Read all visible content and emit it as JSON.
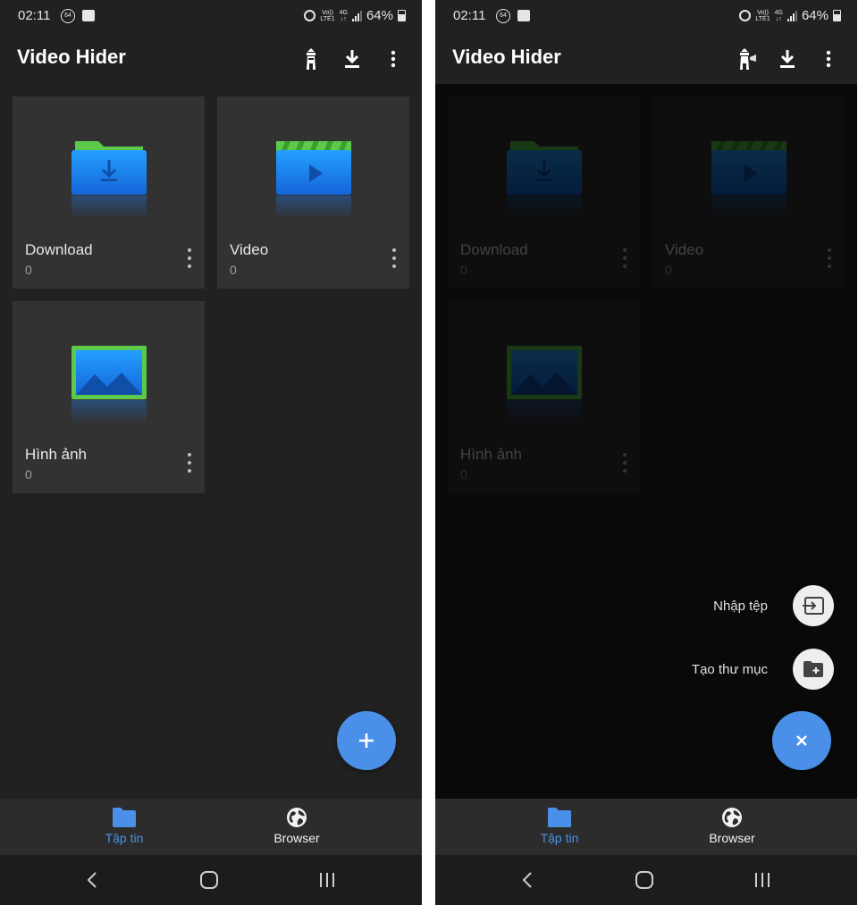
{
  "status_bar": {
    "time": "02:11",
    "notification_badge": "64",
    "carrier_top": "Vo))",
    "carrier_bottom": "LTE1",
    "network_top": "4G",
    "network_bottom": "↓↑",
    "battery": "64%"
  },
  "app": {
    "title": "Video Hider"
  },
  "folders": [
    {
      "name": "Download",
      "count": "0",
      "icon": "download-folder-icon"
    },
    {
      "name": "Video",
      "count": "0",
      "icon": "video-folder-icon"
    },
    {
      "name": "Hình ảnh",
      "count": "0",
      "icon": "image-folder-icon"
    }
  ],
  "fab_menu": {
    "import_label": "Nhập tệp",
    "new_folder_label": "Tạo thư mục"
  },
  "bottom_nav": {
    "files_label": "Tập tin",
    "browser_label": "Browser"
  },
  "colors": {
    "accent": "#4a90e8",
    "background": "#212121",
    "card": "#323232",
    "folder_green": "#4caf50",
    "folder_blue": "#1e88e5"
  }
}
